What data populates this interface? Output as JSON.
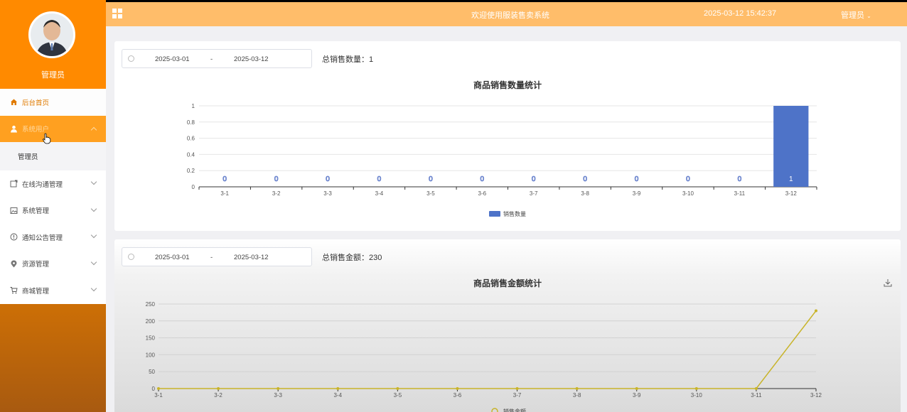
{
  "sidebar": {
    "user_name": "管理员",
    "menu": [
      {
        "label": "后台首页",
        "icon": "home-icon"
      },
      {
        "label": "系统用户",
        "icon": "user-icon"
      },
      {
        "label": "在线沟通管理",
        "icon": "chat-icon"
      },
      {
        "label": "系统管理",
        "icon": "image-icon"
      },
      {
        "label": "通知公告管理",
        "icon": "info-icon"
      },
      {
        "label": "资源管理",
        "icon": "location-icon"
      },
      {
        "label": "商城管理",
        "icon": "cart-icon"
      }
    ],
    "submenu": [
      "管理员"
    ]
  },
  "header": {
    "title": "欢迎使用服装售卖系统",
    "datetime": "2025-03-12 15:42:37",
    "user_menu": "管理员"
  },
  "panel1": {
    "start_date": "2025-03-01",
    "separator": "-",
    "end_date": "2025-03-12",
    "total_label": "总销售数量：1"
  },
  "panel2": {
    "start_date": "2025-03-01",
    "separator": "-",
    "end_date": "2025-03-12",
    "total_label": "总销售金额：230"
  },
  "chart_data": [
    {
      "type": "bar",
      "title": "商品销售数量统计",
      "categories": [
        "3-1",
        "3-2",
        "3-3",
        "3-4",
        "3-5",
        "3-6",
        "3-7",
        "3-8",
        "3-9",
        "3-10",
        "3-11",
        "3-12"
      ],
      "series": [
        {
          "name": "销售数量",
          "values": [
            0,
            0,
            0,
            0,
            0,
            0,
            0,
            0,
            0,
            0,
            0,
            1
          ]
        }
      ],
      "yticks": [
        "0",
        "0.2",
        "0.4",
        "0.6",
        "0.8",
        "1"
      ],
      "ylim": [
        0,
        1
      ],
      "legend": "bottom",
      "color": "#4e73c8"
    },
    {
      "type": "line",
      "title": "商品销售金额统计",
      "categories": [
        "3-1",
        "3-2",
        "3-3",
        "3-4",
        "3-5",
        "3-6",
        "3-7",
        "3-8",
        "3-9",
        "3-10",
        "3-11",
        "3-12"
      ],
      "series": [
        {
          "name": "销售金额",
          "values": [
            0,
            0,
            0,
            0,
            0,
            0,
            0,
            0,
            0,
            0,
            0,
            230
          ]
        }
      ],
      "yticks": [
        "0",
        "50",
        "100",
        "150",
        "200",
        "250"
      ],
      "ylim": [
        0,
        250
      ],
      "legend": "bottom",
      "color": "#c8b42a"
    }
  ]
}
